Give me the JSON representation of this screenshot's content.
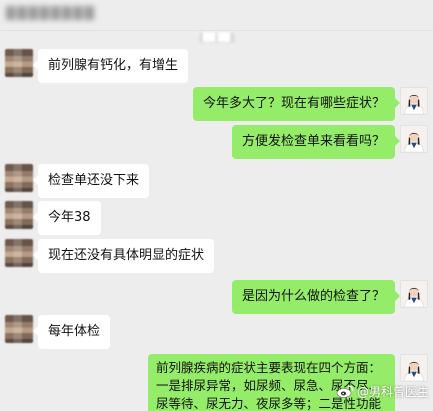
{
  "header": {
    "title": "████████"
  },
  "timestamp": "██ ██",
  "messages": [
    {
      "side": "left",
      "text": "前列腺有钙化，有增生"
    },
    {
      "side": "right",
      "text": "今年多大了？现在有哪些症状？"
    },
    {
      "side": "right",
      "text": "方便发检查单来看看吗？"
    },
    {
      "side": "left",
      "text": "检查单还没下来"
    },
    {
      "side": "left",
      "text": "今年38"
    },
    {
      "side": "left",
      "text": "现在还没有具体明显的症状"
    },
    {
      "side": "right",
      "text": "是因为什么做的检查了？"
    },
    {
      "side": "left",
      "text": "每年体检"
    },
    {
      "side": "right",
      "text": "前列腺疾病的症状主要表现在四个方面：一是排尿异常，如尿频、尿急、尿不尽、尿等待、尿无力、夜尿多等；二是性功能障碍，如勃起缓慢、硬度不坚、早泄、阳痿等；三是神经反射疼痛，如小腹"
    }
  ],
  "watermark": {
    "text": "@男科曾医生",
    "icon": "weibo-icon"
  },
  "colors": {
    "background": "#ededed",
    "self_bubble": "#95ec69",
    "other_bubble": "#ffffff"
  }
}
